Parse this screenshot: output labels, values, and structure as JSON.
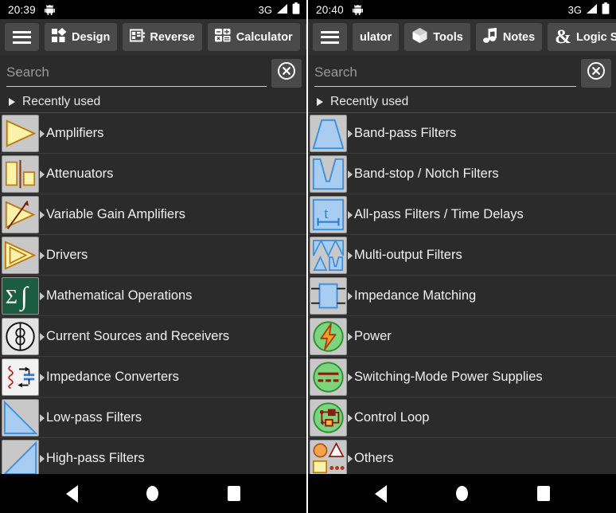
{
  "screens": [
    {
      "id": "left",
      "status": {
        "time": "20:39",
        "network": "3G",
        "android_icon": "android-debug-icon",
        "signal_icon": "signal-icon",
        "battery_icon": "battery-icon"
      },
      "toolbar": {
        "menu_icon": "hamburger-menu-icon",
        "buttons": [
          {
            "label": "Design",
            "icon": "design-blocks-icon"
          },
          {
            "label": "Reverse",
            "icon": "reverse-table-icon"
          },
          {
            "label": "Calculator",
            "icon": "calculator-icon"
          },
          {
            "label": "",
            "icon": "tools-cube-icon"
          }
        ]
      },
      "search": {
        "placeholder": "Search",
        "value": "",
        "clear_icon": "clear-circle-x-icon"
      },
      "section": {
        "label": "Recently used",
        "caret_icon": "caret-right-icon"
      },
      "items": [
        {
          "label": "Amplifiers",
          "icon": "amplifier-triangle-icon"
        },
        {
          "label": "Attenuators",
          "icon": "attenuator-icon"
        },
        {
          "label": "Variable Gain Amplifiers",
          "icon": "variable-gain-amplifier-icon"
        },
        {
          "label": "Drivers",
          "icon": "driver-triangle-icon"
        },
        {
          "label": "Mathematical Operations",
          "icon": "sigma-integral-icon"
        },
        {
          "label": "Current Sources and Receivers",
          "icon": "current-source-icon"
        },
        {
          "label": "Impedance Converters",
          "icon": "impedance-converter-icon"
        },
        {
          "label": "Low-pass Filters",
          "icon": "low-pass-filter-icon"
        },
        {
          "label": "High-pass Filters",
          "icon": "high-pass-filter-icon"
        }
      ],
      "nav": {
        "back": "back-nav-icon",
        "home": "home-nav-icon",
        "recents": "recents-nav-icon"
      }
    },
    {
      "id": "right",
      "status": {
        "time": "20:40",
        "network": "3G",
        "android_icon": "android-debug-icon",
        "signal_icon": "signal-icon",
        "battery_icon": "battery-icon"
      },
      "toolbar": {
        "menu_icon": "hamburger-menu-icon",
        "buttons": [
          {
            "label": "ulator",
            "icon": ""
          },
          {
            "label": "Tools",
            "icon": "tools-cube-icon"
          },
          {
            "label": "Notes",
            "icon": "notes-music-icon"
          },
          {
            "label": "Logic Solver",
            "icon": "ampersand-icon"
          }
        ]
      },
      "search": {
        "placeholder": "Search",
        "value": "",
        "clear_icon": "clear-circle-x-icon"
      },
      "section": {
        "label": "Recently used",
        "caret_icon": "caret-right-icon"
      },
      "items": [
        {
          "label": "Band-pass Filters",
          "icon": "band-pass-filter-icon"
        },
        {
          "label": "Band-stop / Notch Filters",
          "icon": "band-stop-filter-icon"
        },
        {
          "label": "All-pass Filters / Time Delays",
          "icon": "all-pass-filter-icon"
        },
        {
          "label": "Multi-output Filters",
          "icon": "multi-output-filter-icon"
        },
        {
          "label": "Impedance Matching",
          "icon": "impedance-matching-icon"
        },
        {
          "label": "Power",
          "icon": "power-bolt-icon"
        },
        {
          "label": "Switching-Mode Power Supplies",
          "icon": "smps-icon"
        },
        {
          "label": "Control Loop",
          "icon": "control-loop-icon"
        },
        {
          "label": "Others",
          "icon": "others-shapes-icon"
        }
      ],
      "nav": {
        "back": "back-nav-icon",
        "home": "home-nav-icon",
        "recents": "recents-nav-icon"
      }
    }
  ],
  "colors": {
    "app_background": "#2b2b2b",
    "toolbar": "#303030",
    "button": "#4a4a4a",
    "icon_tile": "#c8c8c8",
    "amp_yellow": "#fbf3a8",
    "amp_outline": "#c07a12",
    "filter_blue": "#a9cdf0",
    "filter_outline": "#3d8fe0",
    "green": "#7cd47c",
    "green_outline": "#2f8f2f",
    "dark_red": "#8b1a12",
    "math_green": "#1b5c42",
    "text": "#f1f1f1",
    "placeholder": "#9a9a9a"
  }
}
